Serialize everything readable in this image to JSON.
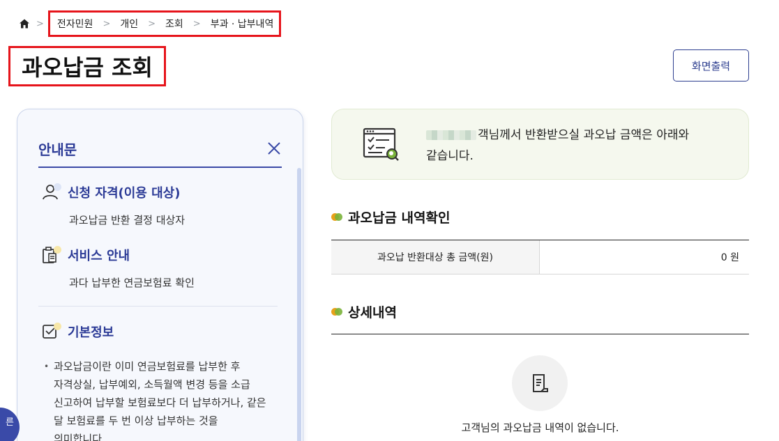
{
  "breadcrumb": {
    "items": [
      "전자민원",
      "개인",
      "조회",
      "부과 · 납부내역"
    ],
    "separator": ">"
  },
  "page": {
    "title": "과오납금 조회",
    "print_label": "화면출력"
  },
  "info_panel": {
    "title": "안내문",
    "sections": [
      {
        "title": "신청 자격(이용 대상)",
        "desc": "과오납금 반환 결정 대상자",
        "icon": "person-icon"
      },
      {
        "title": "서비스 안내",
        "desc": "과다 납부한 연금보험료 확인",
        "icon": "clipboard-icon"
      },
      {
        "title": "기본정보",
        "icon": "checkbox-icon",
        "lines": [
          "과오납금이란 이미 연금보험료를 납부한 후",
          "자격상실, 납부예외, 소득월액 변경 등을 소급",
          "신고하여 납부할 보험료보다 더 납부하거나, 같은",
          "달 보험료를 두 번 이상 납부하는 것을",
          "의미합니다."
        ]
      }
    ],
    "floating_label": "른"
  },
  "notice": {
    "text_line1": "객님께서 반환받으실 과오납 금액은 아래와",
    "text_line2": "같습니다."
  },
  "summary": {
    "title": "과오납금 내역확인",
    "label": "과오납 반환대상 총 금액(원)",
    "value": "0 원"
  },
  "detail": {
    "title": "상세내역",
    "empty_text": "고객님의 과오납금 내역이 없습니다."
  },
  "colors": {
    "highlight": "#e6141b",
    "primary": "#2b3a96",
    "notice_bg": "#f5f8ee"
  }
}
